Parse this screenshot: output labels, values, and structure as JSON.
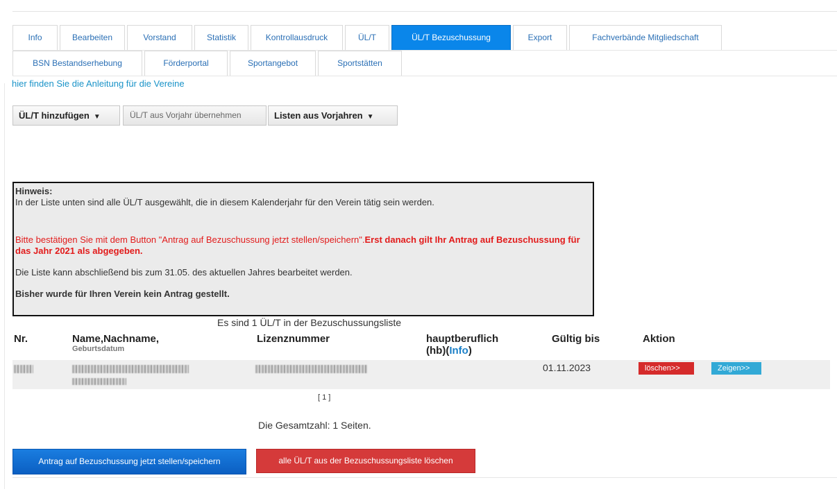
{
  "tabs": {
    "row1": [
      "Info",
      "Bearbeiten",
      "Vorstand",
      "Statistik",
      "Kontrollausdruck",
      "ÜL/T",
      "ÜL/T Bezuschussung",
      "Export",
      "Fachverbände Mitgliedschaft"
    ],
    "row2": [
      "BSN Bestandserhebung",
      "Förderportal",
      "Sportangebot",
      "Sportstätten"
    ],
    "active": "ÜL/T Bezuschussung"
  },
  "guide_link": "hier finden Sie die Anleitung für die Vereine",
  "toolbar": {
    "add_label": "ÜL/T hinzufügen",
    "copy_prev_label": "ÜL/T aus Vorjahr übernehmen",
    "prev_lists_label": "Listen aus Vorjahren"
  },
  "notice": {
    "title": "Hinweis:",
    "line1": "In der Liste unten sind alle ÜL/T ausgewählt, die in diesem Kalenderjahr für den Verein tätig sein werden.",
    "red_normal": "Bitte bestätigen Sie mit dem Button \"Antrag auf Bezuschussung jetzt stellen/speichern\".",
    "red_bold": "Erst danach gilt Ihr Antrag auf Bezuschussung für das Jahr 2021 als abgegeben.",
    "line3": "Die Liste kann abschließend bis zum 31.05. des aktuellen Jahres bearbeitet werden.",
    "line4": "Bisher wurde für Ihren Verein kein Antrag gestellt."
  },
  "count_line": "Es sind 1 ÜL/T in der Bezuschussungsliste",
  "table": {
    "headers": {
      "nr": "Nr.",
      "name": "Name,Nachname,",
      "name2": "Geburtsdatum",
      "license": "Lizenznummer",
      "fulltime": "hauptberuflich",
      "fulltime_hb": "(hb)(",
      "fulltime_info": "Info",
      "fulltime_close": ")",
      "valid_until": "Gültig bis",
      "action": "Aktion"
    },
    "rows": [
      {
        "valid_until": "01.11.2023",
        "delete_label": "löschen>>",
        "show_label": "Zeigen>>"
      }
    ]
  },
  "pager": "[ 1 ]",
  "total_pages": "Die Gesamtzahl: 1 Seiten.",
  "actions": {
    "submit_label": "Antrag auf Bezuschussung jetzt stellen/speichern",
    "clear_label": "alle ÜL/T aus der Bezuschussungsliste löschen"
  }
}
